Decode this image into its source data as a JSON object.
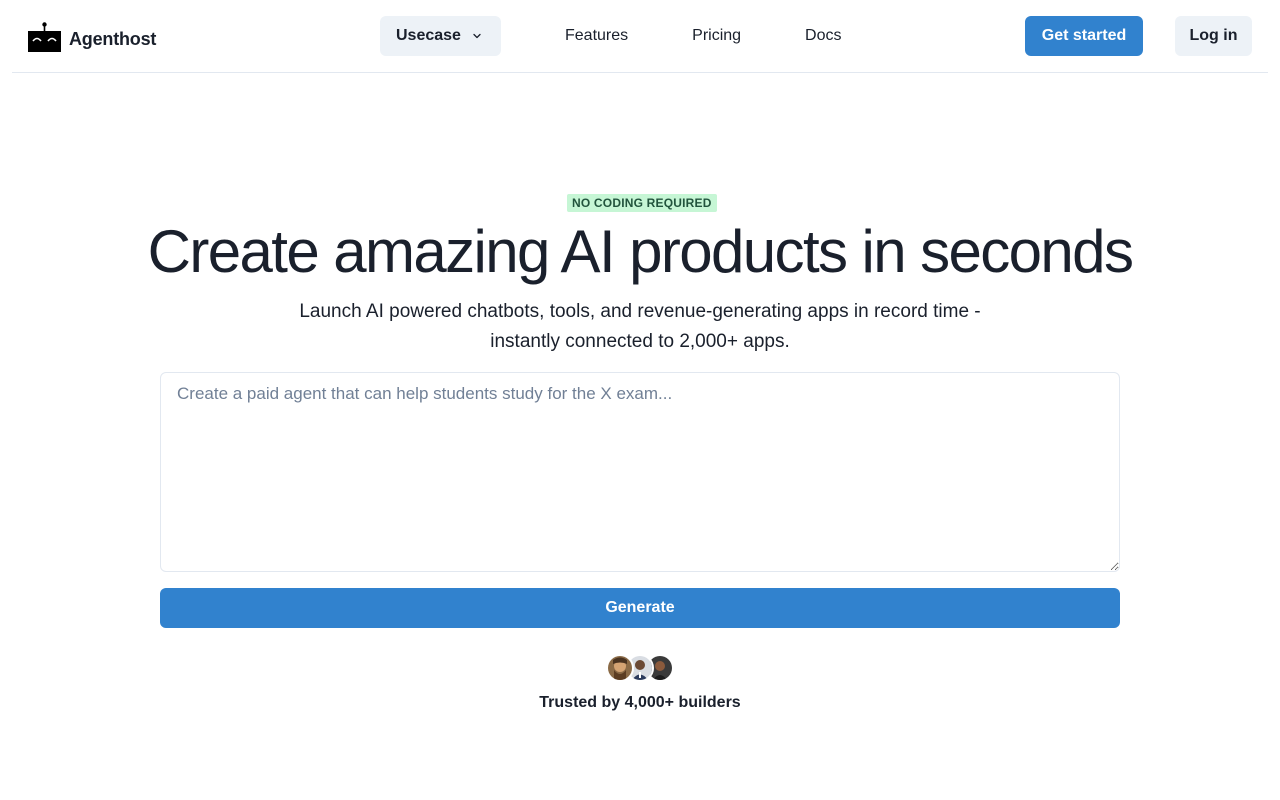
{
  "brand": {
    "name": "Agenthost"
  },
  "nav": {
    "usecase_label": "Usecase",
    "links": [
      "Features",
      "Pricing",
      "Docs"
    ],
    "get_started_label": "Get started",
    "login_label": "Log in"
  },
  "hero": {
    "badge": "NO CODING REQUIRED",
    "title": "Create amazing AI products in seconds",
    "subtitle_line1": "Launch AI powered chatbots, tools, and revenue-generating apps in record time -",
    "subtitle_line2": "instantly connected to 2,000+ apps.",
    "prompt_placeholder": "Create a paid agent that can help students study for the X exam...",
    "prompt_value": "",
    "generate_label": "Generate",
    "trusted_text": "Trusted by 4,000+ builders"
  },
  "colors": {
    "primary": "#3182ce",
    "badge_bg": "#c6f6d5",
    "badge_text": "#22543d",
    "secondary_bg": "#edf2f7"
  },
  "icons": [
    "robot-logo-icon",
    "chevron-down-icon"
  ]
}
